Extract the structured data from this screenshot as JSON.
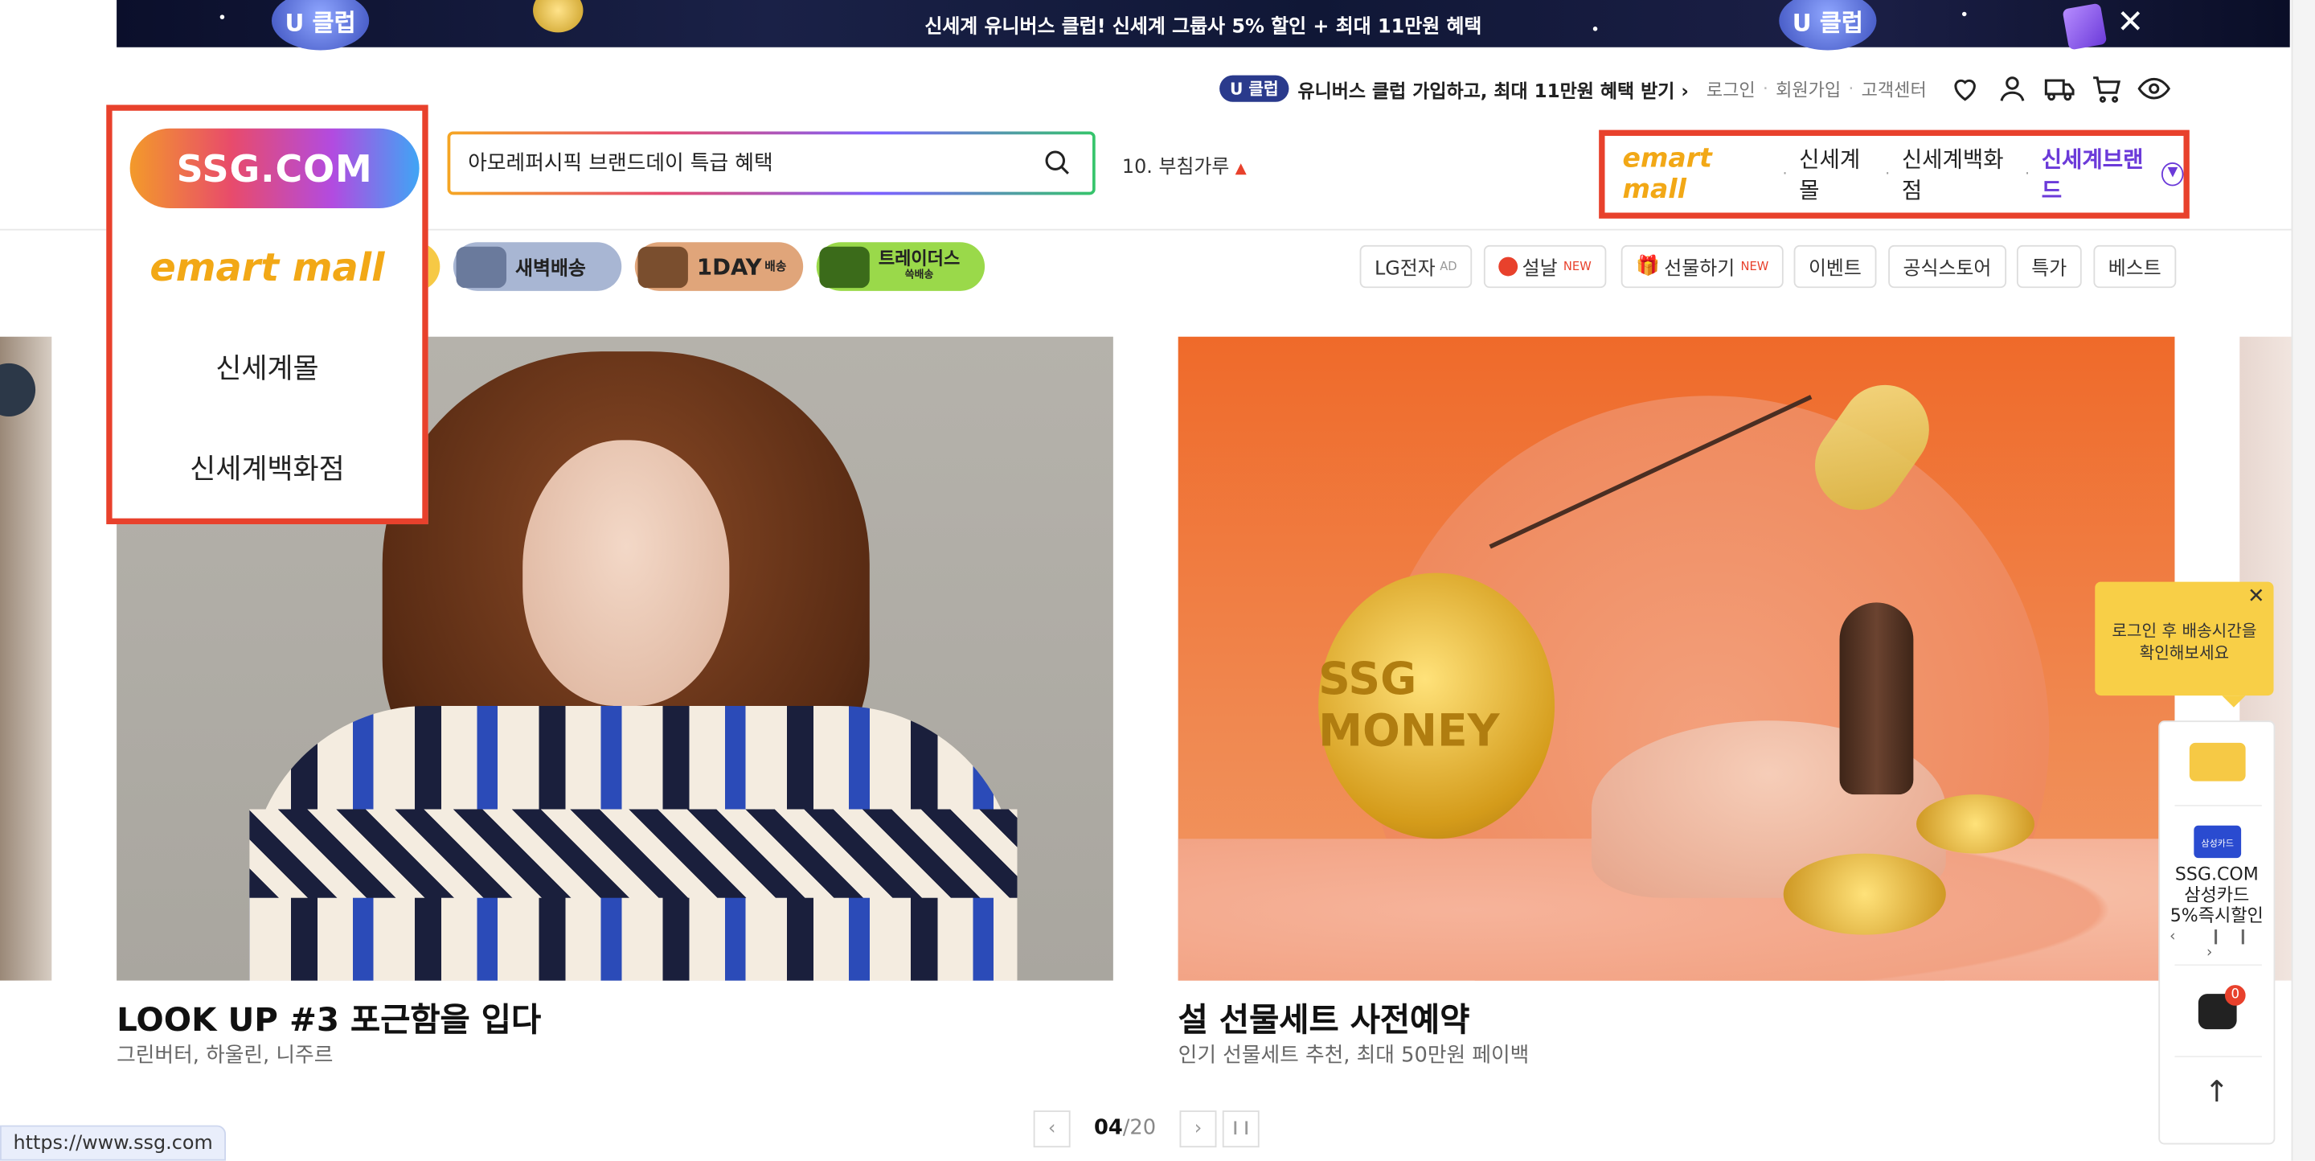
{
  "promo": {
    "text": "신세계 유니버스 클럽! 신세계 그룹사 5% 할인 + 최대 11만원 혜택",
    "badge": "U 클럽",
    "close": "✕"
  },
  "util": {
    "badge": "U 클럽",
    "uclub_text": "유니버스 클럽 가입하고, 최대 11만원 혜택 받기",
    "arrow": "›",
    "links": [
      "로그인",
      "회원가입",
      "고객센터"
    ],
    "sep": "·"
  },
  "logo_panel": {
    "ssg": "SSG.COM",
    "emart": "emart mall",
    "items": [
      "신세계몰",
      "신세계백화점"
    ]
  },
  "search": {
    "value": "아모레퍼시픽 브랜드데이 특급 혜택"
  },
  "rank": {
    "text": "10. 부침가루",
    "trend": "▲"
  },
  "family": {
    "emart": "emart mall",
    "items": [
      "신세계몰",
      "신세계백화점"
    ],
    "brand": "신세계브랜드",
    "sep": "·"
  },
  "pills": {
    "dawn": "새벽배송",
    "oneday": "1DAY",
    "oneday_sub": "배송",
    "trader": "트레이더스",
    "trader_sub": "쓱배송"
  },
  "chips": [
    {
      "label": "LG전자",
      "tag": "AD"
    },
    {
      "label": "설날",
      "tag": "NEW"
    },
    {
      "label": "선물하기",
      "tag": "NEW"
    },
    {
      "label": "이벤트",
      "tag": ""
    },
    {
      "label": "공식스토어",
      "tag": ""
    },
    {
      "label": "특가",
      "tag": ""
    },
    {
      "label": "베스트",
      "tag": ""
    }
  ],
  "banners": [
    {
      "title": "LOOK UP #3 포근함을 입다",
      "subtitle": "그린버터, 하울린, 니주르"
    },
    {
      "title": "설 선물세트 사전예약",
      "subtitle": "인기 선물세트 추천, 최대 50만원 페이백",
      "coin_text": "SSG MONEY"
    }
  ],
  "pager": {
    "current": "04",
    "total": "20",
    "sep": "/",
    "prev": "‹",
    "next": "›",
    "pause": "❙❙"
  },
  "status_url": "https://www.ssg.com",
  "floating": {
    "tooltip_line1": "로그인 후 배송시간을",
    "tooltip_line2": "확인해보세요",
    "tooltip_close": "✕",
    "card_mini": "삼성카드",
    "ad_line1": "SSG.COM",
    "ad_line2": "삼성카드",
    "ad_line3": "5%즉시할인",
    "ad_ctrl": "‹ ❙❙ ›",
    "cart_count": "0",
    "top": "↑"
  },
  "colors": {
    "highlight": "#e8412c",
    "brand_purple": "#6b3ad9",
    "emart_yellow": "#f2a816"
  }
}
